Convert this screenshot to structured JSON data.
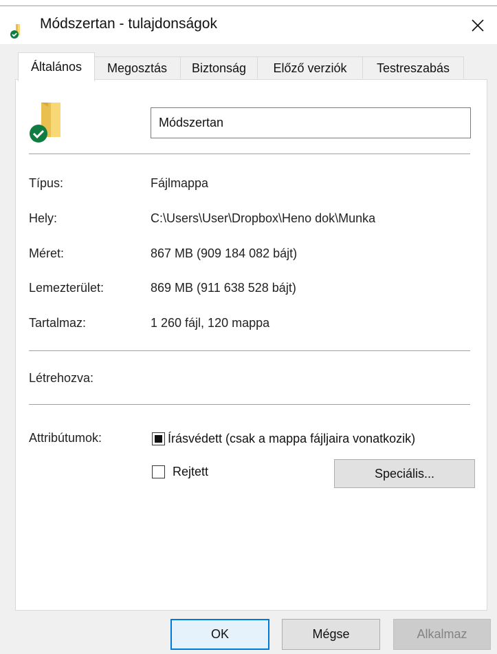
{
  "window": {
    "title": "Módszertan - tulajdonságok"
  },
  "tabs": [
    {
      "label": "Általános",
      "active": true
    },
    {
      "label": "Megosztás",
      "active": false
    },
    {
      "label": "Biztonság",
      "active": false
    },
    {
      "label": "Előző verziók",
      "active": false
    },
    {
      "label": "Testreszabás",
      "active": false
    }
  ],
  "general": {
    "name_value": "Módszertan",
    "type_label": "Típus:",
    "type_value": "Fájlmappa",
    "location_label": "Hely:",
    "location_value": "C:\\Users\\User\\Dropbox\\Heno dok\\Munka",
    "size_label": "Méret:",
    "size_value": "867 MB (909 184 082 bájt)",
    "disk_label": "Lemezterület:",
    "disk_value": "869 MB (911 638 528 bájt)",
    "contains_label": "Tartalmaz:",
    "contains_value": "1 260 fájl, 120 mappa",
    "created_label": "Létrehozva:",
    "created_value": "",
    "attributes_label": "Attribútumok:",
    "readonly_label": "Írásvédett (csak a mappa fájljaira vonatkozik)",
    "readonly_state": "indeterminate",
    "hidden_label": "Rejtett",
    "hidden_checked": false,
    "advanced_button": "Speciális..."
  },
  "footer": {
    "ok": "OK",
    "cancel": "Mégse",
    "apply": "Alkalmaz"
  },
  "icons": {
    "title_icon": "folder-sync-icon",
    "folder_icon": "folder-sync-icon",
    "close_icon": "close-icon"
  },
  "colors": {
    "sync_badge": "#107c41",
    "folder_yellow": "#f8d775",
    "accent": "#0078d7"
  }
}
